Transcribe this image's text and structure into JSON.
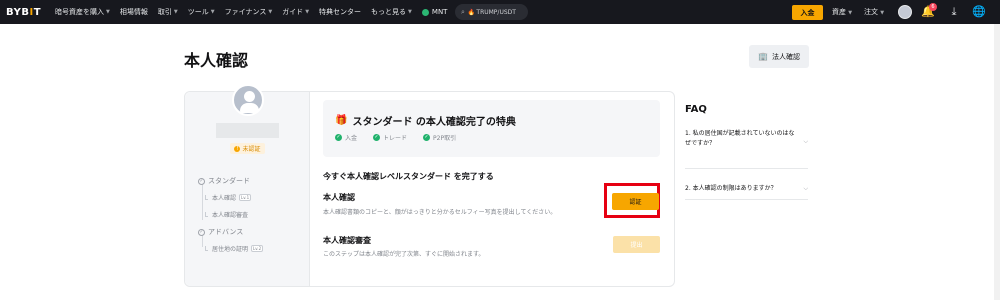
{
  "topbar": {
    "logo_main": "BYB",
    "logo_accent": "I",
    "logo_tail": "T",
    "nav": [
      {
        "label": "暗号資産を購入",
        "chevron": true
      },
      {
        "label": "相場情報",
        "chevron": false
      },
      {
        "label": "取引",
        "chevron": true
      },
      {
        "label": "ツール",
        "chevron": true
      },
      {
        "label": "ファイナンス",
        "chevron": true
      },
      {
        "label": "ガイド",
        "chevron": true
      },
      {
        "label": "特典センター",
        "chevron": false
      },
      {
        "label": "もっと見る",
        "chevron": true
      },
      {
        "label": "MNT",
        "chevron": false
      }
    ],
    "search_text": "TRUMP/USDT",
    "deposit": "入金",
    "assets": "資産",
    "orders": "注文",
    "notif_count": "6"
  },
  "page": {
    "title": "本人確認",
    "corp_button": "法人確認"
  },
  "sidebar": {
    "status": "未認証",
    "levels": [
      {
        "label": "スタンダード",
        "items": [
          {
            "label": "本人確認",
            "tag": "Lv.1"
          },
          {
            "label": "本人確認審査",
            "tag": ""
          }
        ]
      },
      {
        "label": "アドバンス",
        "items": [
          {
            "label": "居住地の証明",
            "tag": "Lv.2"
          }
        ]
      }
    ]
  },
  "benefits": {
    "title": "スタンダード の本人確認完了の特典",
    "perks": [
      "入金",
      "トレード",
      "P2P取引"
    ]
  },
  "steps": {
    "heading": "今すぐ本人確認レベルスタンダード を完了する",
    "items": [
      {
        "title": "本人確認",
        "desc": "本人確認書類のコピーと、顔がはっきりと分かるセルフィー写真を提出してください。",
        "button": "認証"
      },
      {
        "title": "本人確認審査",
        "desc": "このステップは本人確認が完了次第、すぐに開始されます。",
        "button": "提出"
      }
    ]
  },
  "faq": {
    "title": "FAQ",
    "items": [
      "1. 私の居住国が記載されていないのはなぜですか？",
      "2. 本人確認の制限はありますか？"
    ]
  },
  "colors": {
    "accent": "#f7a600",
    "highlight": "#e60012",
    "success": "#20b26c"
  }
}
